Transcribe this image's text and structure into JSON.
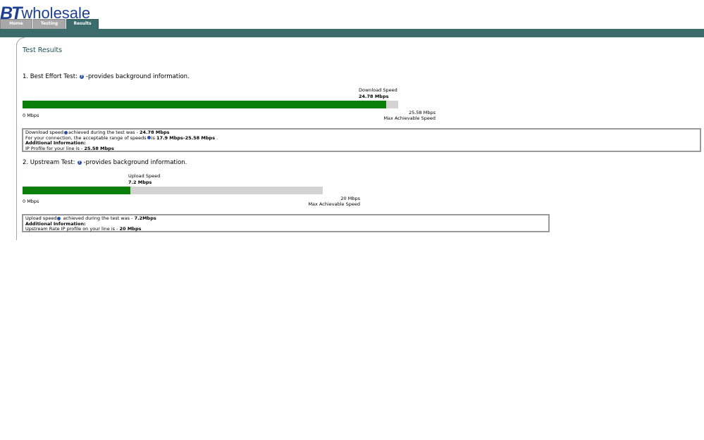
{
  "logo": {
    "bt": "BT",
    "word": "wholesale"
  },
  "tabs": [
    {
      "label": "Home"
    },
    {
      "label": "Testing"
    },
    {
      "label": "Results"
    }
  ],
  "page_title": "Test Results",
  "colors": {
    "brand_blue": "#1c3f94",
    "teal": "#3b6b6b",
    "bar_green": "#0a7f0a",
    "bar_track": "#d3d3d3"
  },
  "download": {
    "heading": "1. Best Effort Test:",
    "heading_suffix": "-provides background information.",
    "speed_label": "Download Speed",
    "speed_value": "24.78 Mbps",
    "fraction": 0.9687,
    "min_label": "0 Mbps",
    "max_value": "25.58 Mbps",
    "max_label": "Max Achievable Speed",
    "info": {
      "line1_prefix": "Download speed",
      "line1_mid": "achieved during the test was - ",
      "line1_value": "24.78 Mbps",
      "line2_prefix": "For your connection, the acceptable range of speeds",
      "line2_mid": "is ",
      "line2_value": "17.9 Mbps-25.58 Mbps",
      "line2_suffix": " .",
      "additional": "Additional Information:",
      "line4_prefix": "IP Profile for your line is - ",
      "line4_value": "25.58 Mbps"
    }
  },
  "upload": {
    "heading": "2. Upstream Test:",
    "heading_suffix": "-provides background information.",
    "speed_label": "Upload Speed",
    "speed_value": "7.2 Mbps",
    "fraction": 0.36,
    "min_label": "0 Mbps",
    "max_value": "20 Mbps",
    "max_label": "Max Achievable Speed",
    "info": {
      "line1_prefix": "Upload speed",
      "line1_mid": " achieved during the test was - ",
      "line1_value": "7.2Mbps",
      "additional": "Additional Information:",
      "line3_prefix": "Upstream Rate IP profile on your line is - ",
      "line3_value": "20 Mbps"
    }
  }
}
